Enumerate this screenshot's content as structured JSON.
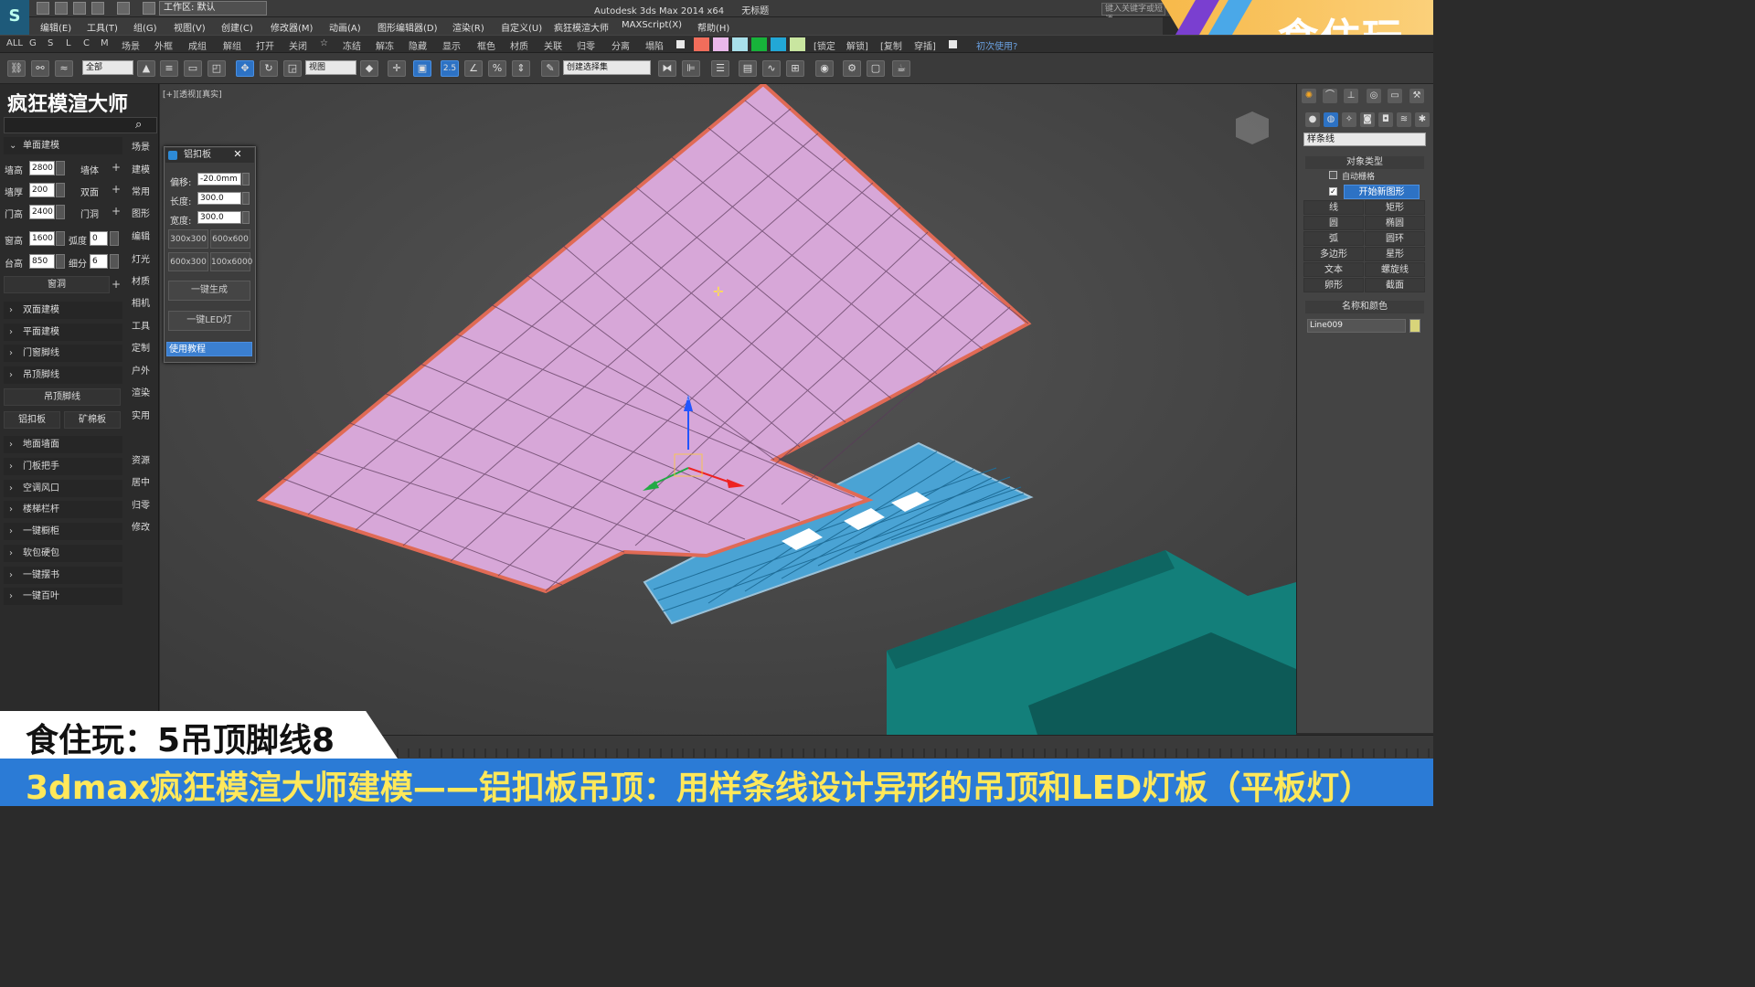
{
  "titlebar": {
    "workspace": "工作区: 默认",
    "app_title": "Autodesk 3ds Max  2014 x64",
    "doc_title": "无标题",
    "search_placeholder": "键入关键字或短语"
  },
  "brand": {
    "text": "食住玩"
  },
  "menu": [
    "编辑(E)",
    "工具(T)",
    "组(G)",
    "视图(V)",
    "创建(C)",
    "修改器(M)",
    "动画(A)",
    "图形编辑器(D)",
    "渲染(R)",
    "自定义(U)",
    "疯狂模渲大师",
    "MAXScript(X)",
    "帮助(H)"
  ],
  "quickbar": {
    "filters": [
      "ALL",
      "G",
      "S",
      "L",
      "C",
      "M"
    ],
    "items": [
      "场景",
      "外框",
      "成组",
      "解组",
      "打开",
      "关闭",
      "☆",
      "冻结",
      "解冻",
      "隐藏",
      "显示",
      "框色",
      "材质",
      "关联",
      "归零",
      "分离",
      "塌陷"
    ],
    "swatches": [
      "#e8e8e8",
      "#f26d5b",
      "#e9b8ea",
      "#a8e0ea",
      "#17b33a",
      "#22a7d6",
      "#c9e6a0"
    ],
    "right_items": [
      "[锁定",
      "解锁]",
      "[复制",
      "穿插]"
    ],
    "help": "初次使用?"
  },
  "toolbar": {
    "filter_dropdown": "全部",
    "view_dropdown": "视图",
    "selection_set": "创建选择集",
    "snap_value": "2.5"
  },
  "left_panel": {
    "title": "疯狂模渲大师",
    "section_single": "单面建模",
    "wall_height_label": "墙高",
    "wall_height": "2800",
    "wall_btn": "墙体",
    "wall_thick_label": "墙厚",
    "wall_thick": "200",
    "double_btn": "双面",
    "door_height_label": "门高",
    "door_height": "2400",
    "door_hole_btn": "门洞",
    "window_height_label": "窗高",
    "window_height": "1600",
    "arc_label": "弧度",
    "arc_value": "0",
    "sill_label": "台高",
    "sill_height": "850",
    "subdiv_label": "细分",
    "subdiv_value": "6",
    "window_hole_btn": "窗洞",
    "sections_a": [
      "双面建模",
      "平面建模",
      "门窗脚线",
      "吊顶脚线"
    ],
    "ceiling_line_btn": "吊顶脚线",
    "alu_btn": "铝扣板",
    "mineral_btn": "矿棉板",
    "sections_b": [
      "地面墙面",
      "门板把手",
      "空调风口",
      "楼梯栏杆",
      "一键橱柜",
      "软包硬包",
      "一键摆书",
      "一键百叶"
    ],
    "categories_a": [
      "场景",
      "建模",
      "常用",
      "图形",
      "编辑",
      "灯光",
      "材质",
      "相机",
      "工具",
      "定制",
      "户外",
      "渲染",
      "实用"
    ],
    "categories_b": [
      "资源",
      "居中",
      "归零",
      "修改"
    ]
  },
  "viewport": {
    "label": "[+][透视][真实]"
  },
  "dialog": {
    "title": "铝扣板",
    "offset_label": "偏移:",
    "offset_value": "-20.0mm",
    "length_label": "长度:",
    "length_value": "300.0",
    "width_label": "宽度:",
    "width_value": "300.0",
    "presets": [
      "300x300",
      "600x600",
      "600x300",
      "100x6000"
    ],
    "generate_btn": "一键生成",
    "led_btn": "一键LED灯",
    "tutorial_btn": "使用教程"
  },
  "right_panel": {
    "category_dropdown": "样条线",
    "object_type_header": "对象类型",
    "auto_grid": "自动栅格",
    "start_new_shape": "开始新图形",
    "buttons": [
      "线",
      "矩形",
      "圆",
      "椭圆",
      "弧",
      "圆环",
      "多边形",
      "星形",
      "文本",
      "螺旋线",
      "卵形",
      "截面"
    ],
    "name_color_header": "名称和颜色",
    "object_name": "Line009",
    "object_color": "#d8d47a"
  },
  "subtitles": {
    "line1": "食住玩：5吊顶脚线8",
    "line2": "3dmax疯狂模渲大师建模——铝扣板吊顶：用样条线设计异形的吊顶和LED灯板（平板灯）"
  }
}
